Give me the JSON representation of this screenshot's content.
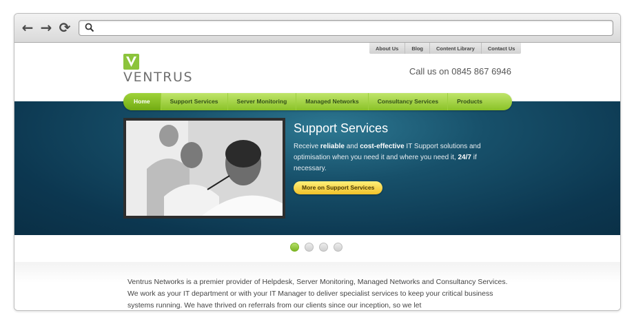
{
  "browser": {
    "back_icon": "arrow-left-icon",
    "forward_icon": "arrow-right-icon",
    "reload_icon": "reload-icon",
    "search_icon": "search-icon",
    "address_value": ""
  },
  "site": {
    "top_links": [
      "About Us",
      "Blog",
      "Content Library",
      "Contact Us"
    ],
    "logo_text": "VENTRUS",
    "phone": "Call us on 0845 867 6946",
    "nav": [
      "Home",
      "Support Services",
      "Server Monitoring",
      "Managed Networks",
      "Consultancy Services",
      "Products"
    ],
    "active_nav": "Home"
  },
  "hero": {
    "title": "Support Services",
    "desc_1": "Receive ",
    "desc_b1": "reliable",
    "desc_2": " and ",
    "desc_b2": "cost-effective",
    "desc_3": " IT Support solutions and optimisation when you need it and where you need it, ",
    "desc_b3": "24/7",
    "desc_4": " if necessary.",
    "cta": "More on Support Services"
  },
  "slider": {
    "count": 4,
    "active": 1
  },
  "intro": "Ventrus Networks is a premier provider of Helpdesk, Server Monitoring, Managed Networks and Consultancy Services. We work as your IT department or with your IT Manager to deliver specialist services to keep your critical business systems running. We have thrived on referrals from our clients since our inception, so we let",
  "colors": {
    "accent_green": "#8cc43c",
    "hero_blue": "#0c3750",
    "cta_yellow": "#f0c12a"
  }
}
